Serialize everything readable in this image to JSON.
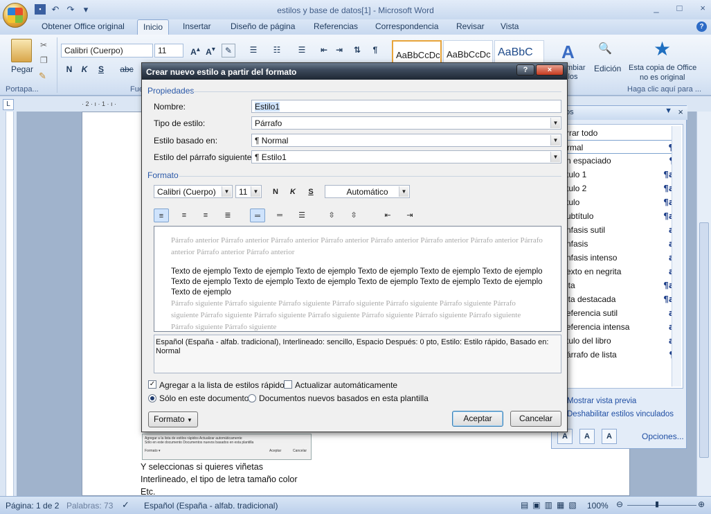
{
  "window": {
    "title": "estilos y base de datos[1] - Microsoft Word",
    "controls": [
      "_",
      "□",
      "×"
    ]
  },
  "qat": {
    "save": "💾",
    "undo": "↶",
    "redo": "↷",
    "more": "▾"
  },
  "tabs": [
    "Obtener Office original",
    "Inicio",
    "Insertar",
    "Diseño de página",
    "Referencias",
    "Correspondencia",
    "Revisar",
    "Vista"
  ],
  "ribbon": {
    "paste": "Pegar",
    "clipboard": "Portapa...",
    "font_group": "Fuente",
    "font_name": "Calibri (Cuerpo)",
    "font_size": "11",
    "bold": "N",
    "italic": "K",
    "underline": "S",
    "strike": "abc",
    "style_samples": [
      "AaBbCcDc",
      "AaBbCcDc",
      "AaBbC"
    ],
    "change_styles": "mbiar\nilos",
    "edit": "Edición",
    "genuine_line1": "Esta copia de Office",
    "genuine_line2": "no es original",
    "genuine_link": "Haga clic aquí para ..."
  },
  "ruler": {
    "marks": "· 2 · ı · 1 · ı ·"
  },
  "document": {
    "line1": "Y seleccionas si quieres viñetas",
    "line2": "Interlineado, el tipo de letra tamaño color",
    "line3": "Etc."
  },
  "status": {
    "page": "Página: 1 de 2",
    "words": "Palabras: 73",
    "language": "Español (España - alfab. tradicional)",
    "zoom": "100%"
  },
  "styles_pane": {
    "title": "os",
    "items": [
      {
        "label": "rrar todo",
        "mark": ""
      },
      {
        "label": "rmal",
        "mark": "¶"
      },
      {
        "label": "n espaciado",
        "mark": "¶"
      },
      {
        "label": "tulo 1",
        "mark": "¶a"
      },
      {
        "label": "tulo 2",
        "mark": "¶a"
      },
      {
        "label": "tulo",
        "mark": "¶a"
      },
      {
        "label": "ubtítulo",
        "mark": "¶a"
      },
      {
        "label": "nfasis sutil",
        "mark": "a"
      },
      {
        "label": "nfasis",
        "mark": "a"
      },
      {
        "label": "nfasis intenso",
        "mark": "a"
      },
      {
        "label": "exto en negrita",
        "mark": "a"
      },
      {
        "label": "ita",
        "mark": "¶a"
      },
      {
        "label": "ita destacada",
        "mark": "¶a"
      },
      {
        "label": "eferencia sutil",
        "mark": "a"
      },
      {
        "label": "eferencia intensa",
        "mark": "a"
      },
      {
        "label": "tulo del libro",
        "mark": "a"
      },
      {
        "label": "árrafo de lista",
        "mark": "¶"
      }
    ],
    "preview_link": "Mostrar vista previa",
    "linked_link": "Deshabilitar estilos vinculados",
    "options_link": "Opciones..."
  },
  "dialog": {
    "title": "Crear nuevo estilo a partir del formato",
    "help": "?",
    "close": "×",
    "props_section": "Propiedades",
    "name_label": "Nombre:",
    "name_value": "Estilo1",
    "type_label": "Tipo de estilo:",
    "type_value": "Párrafo",
    "based_label": "Estilo basado en:",
    "based_value": "¶  Normal",
    "next_label": "Estilo del párrafo siguiente:",
    "next_value": "¶  Estilo1",
    "format_section": "Formato",
    "font": "Calibri (Cuerpo)",
    "size": "11",
    "bold": "N",
    "italic": "K",
    "underline": "S",
    "color": "Automático",
    "preview_prev": "Párrafo anterior Párrafo anterior Párrafo anterior Párrafo anterior Párrafo anterior Párrafo anterior Párrafo anterior Párrafo anterior Párrafo anterior Párrafo anterior",
    "preview_sample": "Texto de ejemplo Texto de ejemplo Texto de ejemplo Texto de ejemplo Texto de ejemplo Texto de ejemplo Texto de ejemplo Texto de ejemplo Texto de ejemplo Texto de ejemplo Texto de ejemplo Texto de ejemplo Texto de ejemplo",
    "preview_next": "Párrafo siguiente Párrafo siguiente Párrafo siguiente Párrafo siguiente Párrafo siguiente Párrafo siguiente Párrafo siguiente Párrafo siguiente Párrafo siguiente Párrafo siguiente Párrafo siguiente Párrafo siguiente Párrafo siguiente Párrafo siguiente Párrafo siguiente",
    "description": "Español (España - alfab. tradicional), Interlineado:  sencillo, Espacio Después:  0 pto, Estilo: Estilo rápido, Basado en: Normal",
    "add_quick": "Agregar a la lista de estilos rápidos",
    "auto_update": "Actualizar automáticamente",
    "only_doc": "Sólo en este documento",
    "new_docs": "Documentos nuevos basados en esta plantilla",
    "format_btn": "Formato",
    "ok": "Aceptar",
    "cancel": "Cancelar"
  },
  "mini_dialog": {
    "l1": "Agregar a la lista de estilos rápidos   Actualizar automáticamente",
    "l2": "Sólo en este documento   Documentos nuevos basados en esta plantilla",
    "l3": "Formato ▾",
    "ok": "Aceptar",
    "cancel": "Cancelar"
  }
}
